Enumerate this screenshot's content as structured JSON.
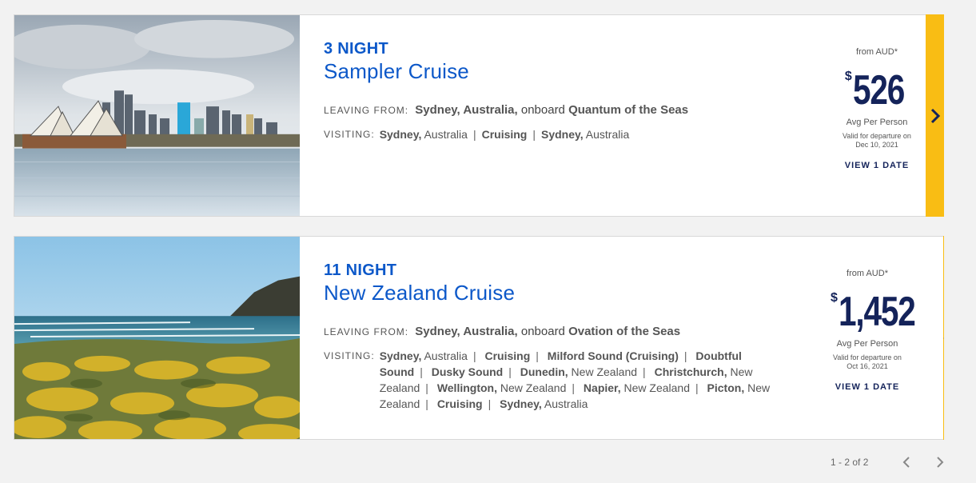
{
  "colors": {
    "accent_blue": "#0c58c9",
    "price_navy": "#14235a",
    "arrow_bar": "#f9bd14"
  },
  "cruises": [
    {
      "image": "sydney-opera-house-photo",
      "nights": "3 NIGHT",
      "title": "Sampler Cruise",
      "leaving_label": "LEAVING FROM:",
      "leaving_port": "Sydney, Australia,",
      "onboard_text": " onboard ",
      "ship": "Quantum of the Seas",
      "visiting_label": "VISITING:",
      "itinerary": [
        {
          "bold": "Sydney,",
          "rest": " Australia"
        },
        {
          "bold": "Cruising",
          "rest": ""
        },
        {
          "bold": "Sydney,",
          "rest": " Australia"
        }
      ],
      "from_label": "from AUD*",
      "currency_symbol": "$",
      "price": "526",
      "avg_label": "Avg Per Person",
      "valid_line1": "Valid for departure on",
      "valid_line2": "Dec 10, 2021",
      "view_dates": "VIEW 1 DATE"
    },
    {
      "image": "new-zealand-coast-photo",
      "nights": "11 NIGHT",
      "title": "New Zealand Cruise",
      "leaving_label": "LEAVING FROM:",
      "leaving_port": "Sydney, Australia,",
      "onboard_text": " onboard ",
      "ship": "Ovation of the Seas",
      "visiting_label": "VISITING:",
      "itinerary": [
        {
          "bold": "Sydney,",
          "rest": " Australia"
        },
        {
          "bold": "Cruising",
          "rest": ""
        },
        {
          "bold": "Milford Sound (Cruising)",
          "rest": ""
        },
        {
          "bold": "Doubtful Sound",
          "rest": ""
        },
        {
          "bold": "Dusky Sound",
          "rest": ""
        },
        {
          "bold": "Dunedin,",
          "rest": " New Zealand"
        },
        {
          "bold": "Christchurch,",
          "rest": " New Zealand"
        },
        {
          "bold": "Wellington,",
          "rest": " New Zealand"
        },
        {
          "bold": "Napier,",
          "rest": " New Zealand"
        },
        {
          "bold": "Picton,",
          "rest": " New Zealand"
        },
        {
          "bold": "Cruising",
          "rest": ""
        },
        {
          "bold": "Sydney,",
          "rest": " Australia"
        }
      ],
      "from_label": "from AUD*",
      "currency_symbol": "$",
      "price": "1,452",
      "avg_label": "Avg Per Person",
      "valid_line1": "Valid for departure on",
      "valid_line2": "Oct 16, 2021",
      "view_dates": "VIEW 1 DATE"
    }
  ],
  "pagination": {
    "count": "1 - 2 of 2",
    "prev_icon": "chevron-left-icon",
    "next_icon": "chevron-right-icon"
  }
}
